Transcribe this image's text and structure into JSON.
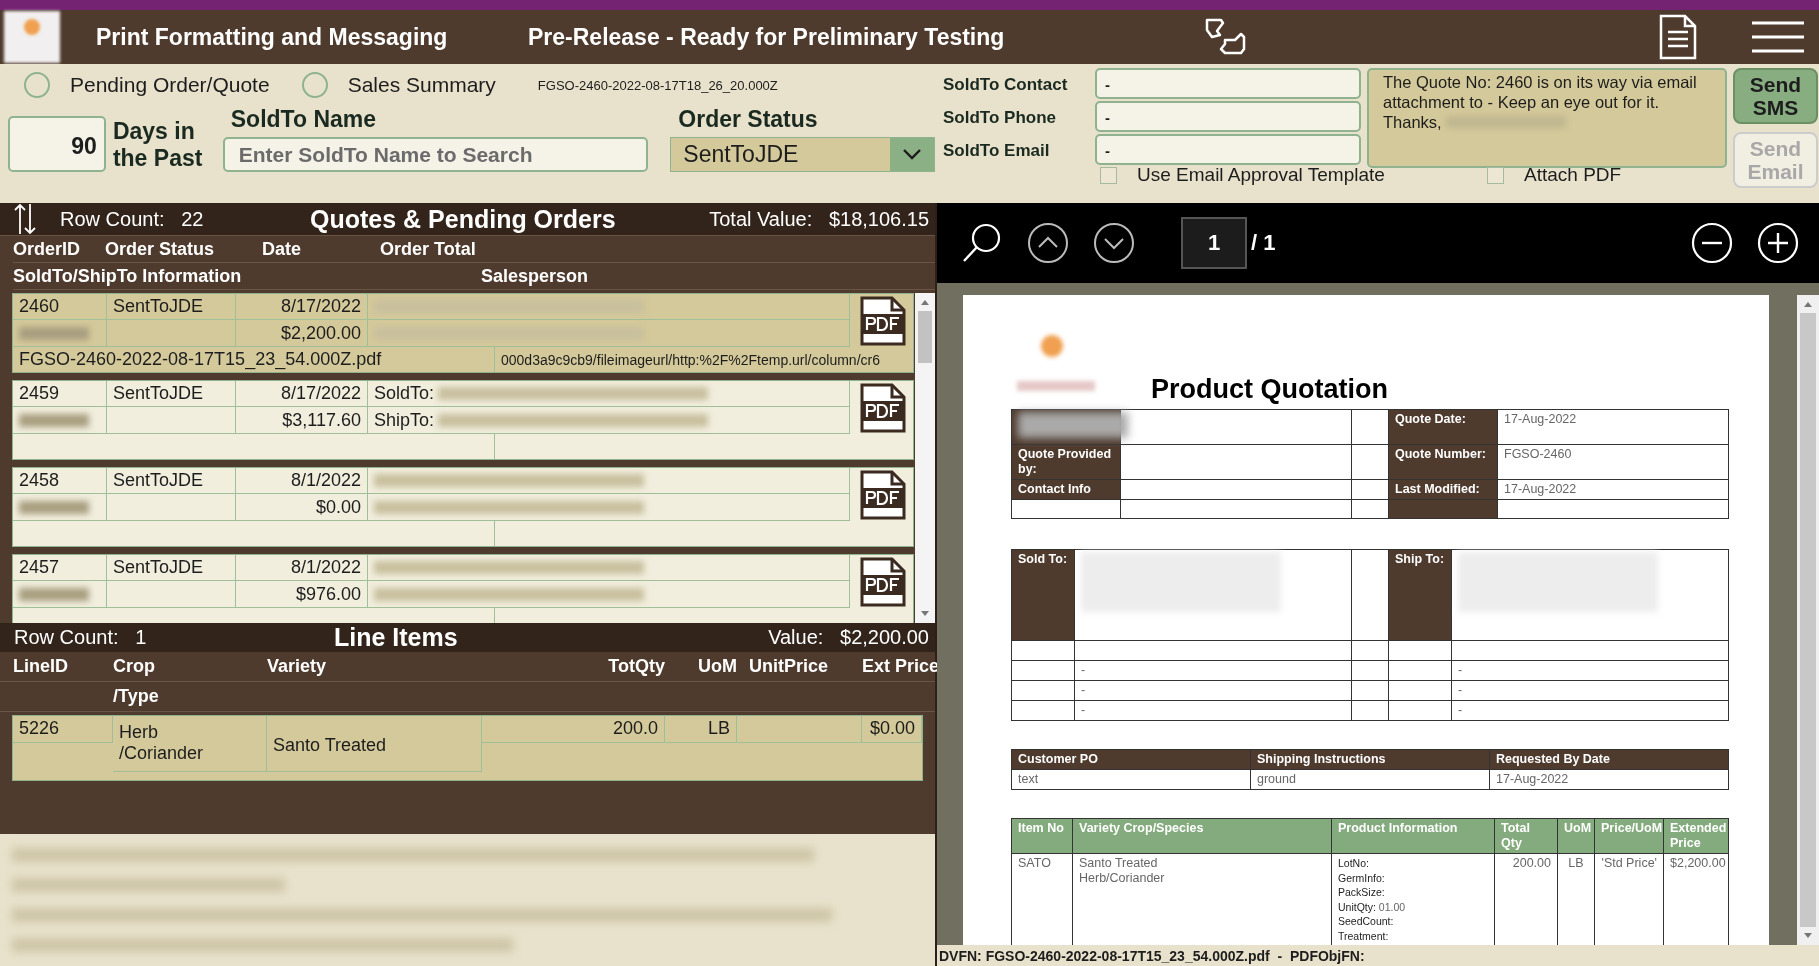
{
  "header": {
    "title": "Print Formatting and Messaging",
    "subtitle": "Pre-Release - Ready for Preliminary Testing"
  },
  "modes": [
    {
      "label": "Pending Order/Quote",
      "selected": false
    },
    {
      "label": "Sales Summary",
      "selected": false
    }
  ],
  "file_id": "FGSO-2460-2022-08-17T18_26_20.000Z",
  "days": {
    "value": "90",
    "label": "Days in the Past"
  },
  "soldto_name": {
    "label": "SoldTo Name",
    "placeholder": "Enter SoldTo Name to Search"
  },
  "order_status": {
    "label": "Order Status",
    "value": "SentToJDE"
  },
  "contact_fields": [
    {
      "label": "SoldTo Contact",
      "value": "-"
    },
    {
      "label": "SoldTo Phone",
      "value": "-"
    },
    {
      "label": "SoldTo Email",
      "value": "-"
    }
  ],
  "message": "The Quote No: 2460 is on its way via email attachment to - Keep an eye out for it.  Thanks,",
  "buttons": [
    {
      "label": "Send SMS",
      "disabled": false
    },
    {
      "label": "Send Email",
      "disabled": true
    }
  ],
  "options": [
    {
      "label": "Use Email Approval Template",
      "checked": false
    },
    {
      "label": "Attach PDF",
      "checked": false
    }
  ],
  "orders": {
    "row_count_label": "Row Count:",
    "row_count": "22",
    "title": "Quotes & Pending Orders",
    "total_label": "Total Value:",
    "total": "$18,106.15",
    "columns": [
      "OrderID",
      "Order Status",
      "Date",
      "Order Total"
    ],
    "columns_2": [
      "SoldTo/ShipTo Information",
      "Salesperson"
    ],
    "rows": [
      {
        "id": "2460",
        "status": "SentToJDE",
        "date": "8/17/2022",
        "total": "$2,200.00",
        "selected": true,
        "file": "FGSO-2460-2022-08-17T15_23_54.000Z.pdf",
        "url": "000d3a9c9cb9/fileimageurl/http:%2F%2Ftemp.url/column/cr6"
      },
      {
        "id": "2459",
        "status": "SentToJDE",
        "date": "8/17/2022",
        "total": "$3,117.60",
        "selected": false,
        "soldto_label": "SoldTo:",
        "shipto_label": "ShipTo:"
      },
      {
        "id": "2458",
        "status": "SentToJDE",
        "date": "8/1/2022",
        "total": "$0.00",
        "selected": false
      },
      {
        "id": "2457",
        "status": "SentToJDE",
        "date": "8/1/2022",
        "total": "$976.00",
        "selected": false
      }
    ]
  },
  "line_items": {
    "row_count_label": "Row Count:",
    "row_count": "1",
    "title": "Line Items",
    "value_label": "Value:",
    "value": "$2,200.00",
    "columns": [
      "LineID",
      "Crop",
      "Variety",
      "TotQty",
      "UoM",
      "UnitPrice",
      "Ext Price"
    ],
    "crop_sub": "/Type",
    "rows": [
      {
        "id": "5226",
        "crop": "Herb",
        "type": "/Coriander",
        "variety": "Santo Treated",
        "qty": "200.0",
        "uom": "LB",
        "unit_price": "",
        "ext_price": "$0.00"
      }
    ]
  },
  "viewer": {
    "page": "1",
    "page_total": "/ 1"
  },
  "document": {
    "title": "Product Quotation",
    "left_labels": [
      "Quote Provided by:",
      "Contact Info"
    ],
    "info": [
      {
        "label": "Quote Date:",
        "value": "17-Aug-2022"
      },
      {
        "label": "Quote Number:",
        "value": "FGSO-2460"
      },
      {
        "label": "Last Modified:",
        "value": "17-Aug-2022"
      }
    ],
    "sold_to": "Sold To:",
    "ship_to": "Ship To:",
    "address_rows": [
      [
        "",
        ""
      ],
      [
        "-",
        "-"
      ],
      [
        "-",
        "-"
      ],
      [
        "-",
        "-"
      ]
    ],
    "shipping_headers": [
      "Customer PO",
      "Shipping Instructions",
      "Requested By Date"
    ],
    "shipping_values": [
      "text",
      "ground",
      "17-Aug-2022"
    ],
    "item_headers": [
      "Item No",
      "Variety Crop/Species",
      "Product Information",
      "Total Qty",
      "UoM",
      "Price/UoM",
      "Extended Price"
    ],
    "item": {
      "item_no": "SATO",
      "variety": "Santo Treated",
      "crop": "Herb/Coriander",
      "info": [
        {
          "label": "LotNo:"
        },
        {
          "label": "GermInfo:"
        },
        {
          "label": "PackSize:"
        },
        {
          "label": "UnitQty:",
          "value": "01.00"
        },
        {
          "label": "SeedCount:"
        },
        {
          "label": "Treatment:"
        }
      ],
      "qty": "200.00",
      "uom": "LB",
      "price": "'Std Price'",
      "ext": "$2,200.00"
    }
  },
  "status_bar": "DVFN: FGSO-2460-2022-08-17T15_23_54.000Z.pdf  -  PDFObjFN:"
}
